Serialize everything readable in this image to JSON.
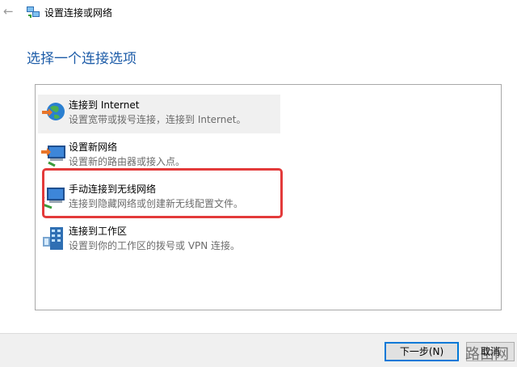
{
  "window": {
    "title": "设置连接或网络"
  },
  "heading": "选择一个连接选项",
  "options": [
    {
      "title": "连接到 Internet",
      "desc": "设置宽带或拨号连接，连接到 Internet。",
      "icon": "globe-network-icon"
    },
    {
      "title": "设置新网络",
      "desc": "设置新的路由器或接入点。",
      "icon": "new-network-icon"
    },
    {
      "title": "手动连接到无线网络",
      "desc": "连接到隐藏网络或创建新无线配置文件。",
      "icon": "wireless-network-icon"
    },
    {
      "title": "连接到工作区",
      "desc": "设置到你的工作区的拨号或 VPN 连接。",
      "icon": "workplace-icon"
    }
  ],
  "buttons": {
    "next": "下一步(N)",
    "cancel": "取消"
  },
  "watermark": "路由网",
  "colors": {
    "heading": "#1d5ca8",
    "highlight": "#e33a3a",
    "primary_border": "#0078d7"
  }
}
